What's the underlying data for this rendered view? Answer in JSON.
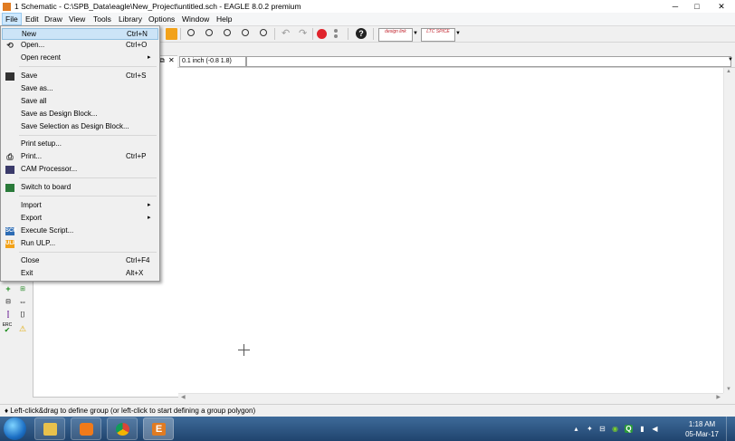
{
  "window": {
    "title": "1 Schematic - C:\\SPB_Data\\eagle\\New_Project\\untitled.sch - EAGLE 8.0.2 premium",
    "minimize": "─",
    "maximize": "□",
    "close": "✕"
  },
  "menubar": [
    "File",
    "Edit",
    "Draw",
    "View",
    "Tools",
    "Library",
    "Options",
    "Window",
    "Help"
  ],
  "file_menu": {
    "items": [
      {
        "label": "New",
        "shortcut": "Ctrl+N",
        "icon": "",
        "highlighted": true
      },
      {
        "label": "Open...",
        "shortcut": "Ctrl+O",
        "icon": "open-folder-icon"
      },
      {
        "label": "Open recent",
        "shortcut": "",
        "submenu": true
      },
      {
        "label": "Save",
        "shortcut": "Ctrl+S",
        "icon": "floppy-disk-icon"
      },
      {
        "label": "Save as...",
        "shortcut": ""
      },
      {
        "label": "Save all",
        "shortcut": ""
      },
      {
        "label": "Save as Design Block...",
        "shortcut": ""
      },
      {
        "label": "Save Selection as Design Block...",
        "shortcut": ""
      },
      {
        "label": "Print setup...",
        "shortcut": ""
      },
      {
        "label": "Print...",
        "shortcut": "Ctrl+P",
        "icon": "printer-icon"
      },
      {
        "label": "CAM Processor...",
        "shortcut": "",
        "icon": "cam-processor-icon"
      },
      {
        "label": "Switch to board",
        "shortcut": "",
        "icon": "board-icon"
      },
      {
        "label": "Import",
        "shortcut": "",
        "submenu": true
      },
      {
        "label": "Export",
        "shortcut": "",
        "submenu": true
      },
      {
        "label": "Execute Script...",
        "shortcut": "",
        "icon": "script-icon",
        "icon_text": "SCR"
      },
      {
        "label": "Run ULP...",
        "shortcut": "",
        "icon": "ulp-icon",
        "icon_text": "ULP"
      },
      {
        "label": "Close",
        "shortcut": "Ctrl+F4"
      },
      {
        "label": "Exit",
        "shortcut": "Alt+X"
      }
    ]
  },
  "toolbar": {
    "icons": [
      "zoom-fit-icon",
      "zoom-in-icon",
      "zoom-out-icon",
      "zoom-select-icon",
      "zoom-redraw-icon",
      "undo-icon",
      "redo-icon",
      "stop-icon",
      "go-icon",
      "help-icon"
    ],
    "brand1": "design link",
    "brand2": "LTC SPICE"
  },
  "coordinate_readout": "0.1 inch (-0.8 1.8)",
  "left_tools": {
    "icons": [
      "add-icon",
      "value-icon",
      "pinswap-icon",
      "name-icon",
      "split-icon",
      "gate-swap-icon",
      "erc-icon",
      "warning-icon"
    ],
    "erc_text": "ERC"
  },
  "status_text": "♦ Left-click&drag to define group (or left-click to start defining a group polygon)",
  "taskbar": {
    "apps": [
      "explorer-icon",
      "media-player-icon",
      "chrome-icon",
      "eagle-icon"
    ],
    "tray_icons": [
      "tray-up-arrow-icon",
      "dropbox-icon",
      "network-icon",
      "nvidia-icon",
      "quicken-icon",
      "signal-icon",
      "volume-icon"
    ],
    "time": "1:18 AM",
    "date": "05-Mar-17"
  },
  "colors": {
    "accent": "#2d6cb4",
    "taskbar": "#2a4f7c",
    "menu_highlight": "#cce4f7",
    "stop": "#e0242c",
    "eagle": "#e07b22"
  }
}
